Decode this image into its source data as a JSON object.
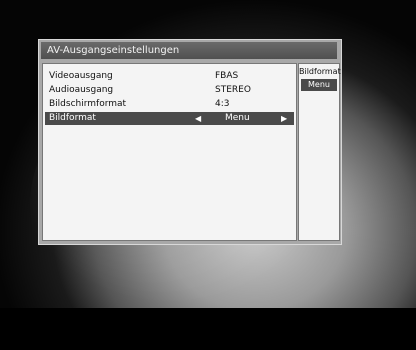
{
  "menu": {
    "title": "AV-Ausgangseinstellungen",
    "rows": [
      {
        "label": "Videoausgang",
        "value": "FBAS"
      },
      {
        "label": "Audioausgang",
        "value": "STEREO"
      },
      {
        "label": "Bildschirmformat",
        "value": "4:3"
      },
      {
        "label": "Bildformat",
        "value": "Menu"
      }
    ]
  },
  "side": {
    "title": "Bildformat",
    "option": "Menu"
  },
  "icons": {
    "left": "arrow-left-icon",
    "right": "arrow-right-icon"
  },
  "colors": {
    "selection": "#4a4a4a",
    "panel": "#f4f4f4",
    "titlebar": "#5a5a5a"
  }
}
